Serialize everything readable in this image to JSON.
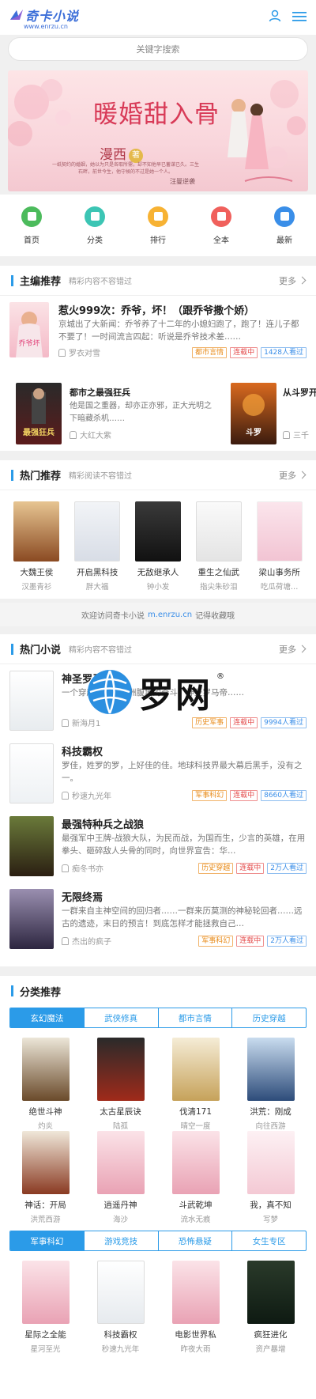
{
  "header": {
    "logo_text": "奇卡小说",
    "logo_url": "www.enrzu.cn",
    "user_icon": "user-icon",
    "menu_icon": "menu-icon"
  },
  "search": {
    "placeholder": "关键字搜索"
  },
  "banner": {
    "title": "暖婚甜入骨",
    "author": "漫西",
    "author_mark": "著",
    "blurb": "一纸契约的婚姻，她以为只是各取所需，却不知他早已蓄谋已久。三生石畔，前世今生，他守候的不过是她一个人。",
    "publisher": "汪曼逆袭"
  },
  "nav": [
    {
      "label": "首页",
      "color": "#4cbb5c"
    },
    {
      "label": "分类",
      "color": "#3cc5b4"
    },
    {
      "label": "排行",
      "color": "#f7b233"
    },
    {
      "label": "全本",
      "color": "#f0605c"
    },
    {
      "label": "最新",
      "color": "#3a8ee8"
    }
  ],
  "editor": {
    "title": "主编推荐",
    "subtitle": "精彩内容不容错过",
    "more": "更多",
    "featured": {
      "title": "惹火999次：乔爷，坏！（跟乔爷撒个娇）",
      "desc": "京城出了大新闻：乔爷养了十二年的小媳妇跑了，跑了！连儿子都不要了！一时间流言四起：听说是乔爷技术差……",
      "author": "罗衣对雪",
      "category": "都市言情",
      "status": "连载中",
      "readers": "1428人看过"
    },
    "pair": [
      {
        "title": "都市之最强狂兵",
        "desc": "他是国之重器，却亦正亦邪，正大光明之下暗藏杀机……",
        "author": "大红大紫"
      },
      {
        "title": "从斗罗开始",
        "desc": "",
        "author": "三千"
      }
    ]
  },
  "hot_recommend": {
    "title": "热门推荐",
    "subtitle": "精彩阅读不容错过",
    "more": "更多",
    "books": [
      {
        "name": "大魏王侯",
        "author": "汉墨青衫"
      },
      {
        "name": "开启黑科技",
        "author": "胖大福"
      },
      {
        "name": "无敌继承人",
        "author": "钟小发"
      },
      {
        "name": "重生之仙武",
        "author": "指尖朱砂泪"
      },
      {
        "name": "梁山事务所",
        "author": "吃瓜荷塘…"
      }
    ]
  },
  "notice": {
    "prefix": "欢迎访问奇卡小说",
    "domain": "m.enrzu.cn",
    "suffix": "记得收藏哦"
  },
  "hot_novels": {
    "title": "热门小说",
    "subtitle": "精彩内容不容错过",
    "more": "更多",
    "watermark": "罗网",
    "books": [
      {
        "title": "神圣罗马帝国",
        "desc": "一个穿越者，在欧洲腹地的奇斗，神圣罗马帝……",
        "author": "新海月1",
        "category": "历史军事",
        "status": "连载中",
        "readers": "9994人看过"
      },
      {
        "title": "科技霸权",
        "desc": "罗佳，姓罗的罗，上好佳的佳。地球科技界最大幕后黑手，没有之一。",
        "author": "秒速九光年",
        "category": "军事科幻",
        "status": "连载中",
        "readers": "8660人看过"
      },
      {
        "title": "最强特种兵之战狼",
        "desc": "最强军中王牌-战狼大队，为民而战，为国而生，少言的英雄，在用拳头、砸碎敌人头骨的同时，向世界宣告：华…",
        "author": "痴冬书亦",
        "category": "历史穿越",
        "status": "连载中",
        "readers": "2万人看过"
      },
      {
        "title": "无限终焉",
        "desc": "一群来自主神空间的回归者……一群来历莫测的神秘轮回者……远古的遗迹，末日的预言！到底怎样才能拯救自己…",
        "author": "杰出的疯子",
        "category": "军事科幻",
        "status": "连载中",
        "readers": "2万人看过"
      }
    ]
  },
  "categories": {
    "title": "分类推荐",
    "tabs1": [
      "玄幻魔法",
      "武侠修真",
      "都市言情",
      "历史穿越"
    ],
    "row1": [
      {
        "name": "绝世斗神",
        "author": "灼炎"
      },
      {
        "name": "太古星辰诀",
        "author": "陆孤"
      },
      {
        "name": "伐清171",
        "author": "晴空一度"
      },
      {
        "name": "洪荒：刚成",
        "author": "向往西游"
      }
    ],
    "row2": [
      {
        "name": "神话：开局",
        "author": "洪荒西游"
      },
      {
        "name": "逍遥丹神",
        "author": "海沙"
      },
      {
        "name": "斗武乾坤",
        "author": "流水无痕"
      },
      {
        "name": "我，真不知",
        "author": "写梦"
      }
    ],
    "tabs2": [
      "军事科幻",
      "游戏竞技",
      "恐怖悬疑",
      "女生专区"
    ],
    "row3": [
      {
        "name": "星际之全能",
        "author": "星河至光"
      },
      {
        "name": "科技霸权",
        "author": "秒速九光年"
      },
      {
        "name": "电影世界私",
        "author": "昨夜大雨"
      },
      {
        "name": "疯狂进化",
        "author": "资产暴增"
      }
    ]
  }
}
